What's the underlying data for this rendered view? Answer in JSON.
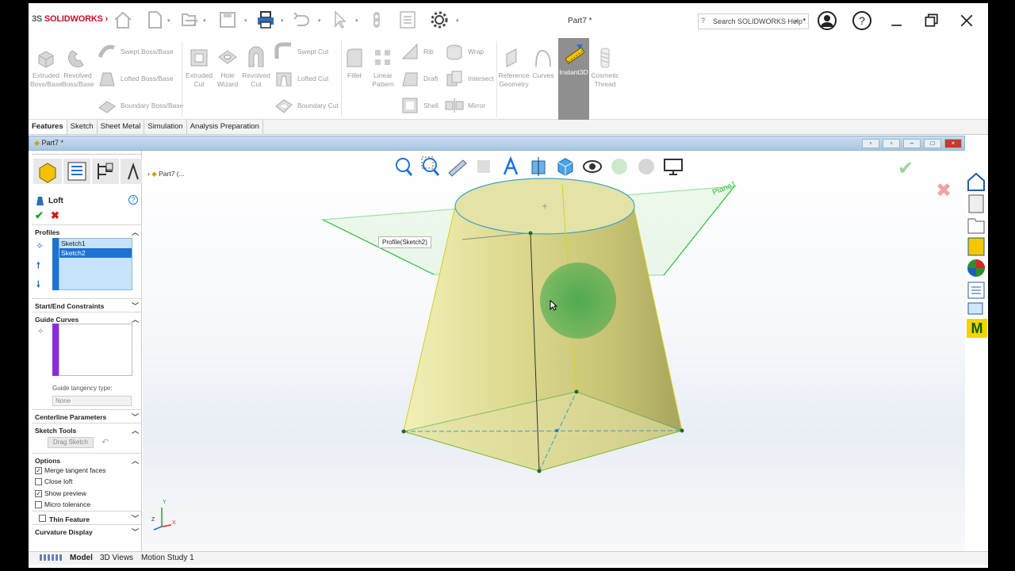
{
  "app": {
    "brand": "SOLIDWORKS",
    "doc_title": "Part7 *",
    "search_placeholder": "Search SOLIDWORKS Help"
  },
  "ribbon": {
    "extruded_boss": "Extruded Boss/Base",
    "revolved_boss": "Revolved Boss/Base",
    "swept_boss": "Swept Boss/Base",
    "lofted_boss": "Lofted Boss/Base",
    "boundary_boss": "Boundary Boss/Base",
    "extruded_cut": "Extruded Cut",
    "hole_wizard": "Hole Wizard",
    "revolved_cut": "Revolved Cut",
    "swept_cut": "Swept Cut",
    "lofted_cut": "Lofted Cut",
    "boundary_cut": "Boundary Cut",
    "fillet": "Fillet",
    "linear_pattern": "Linear Pattern",
    "rib": "Rib",
    "draft": "Draft",
    "shell": "Shell",
    "wrap": "Wrap",
    "intersect": "Intersect",
    "mirror": "Mirror",
    "reference_geometry": "Reference Geometry",
    "curves": "Curves",
    "instant3d": "Instant3D",
    "cosmetic_thread": "Cosmetic Thread"
  },
  "tabs": [
    "Features",
    "Sketch",
    "Sheet Metal",
    "Simulation",
    "Analysis Preparation"
  ],
  "doc_tab": "Part7 *",
  "tree_item": "Part7  (...",
  "pm": {
    "title": "Loft",
    "profiles_label": "Profiles",
    "profiles": [
      "Sketch1",
      "Sketch2"
    ],
    "start_end": "Start/End Constraints",
    "guide_curves": "Guide Curves",
    "tangency_label": "Guide tangency type:",
    "tangency_value": "None",
    "centerline": "Centerline Parameters",
    "sketch_tools": "Sketch Tools",
    "drag_sketch": "Drag Sketch",
    "options": "Options",
    "merge_tangent": "Merge tangent faces",
    "close_loft": "Close loft",
    "show_preview": "Show preview",
    "micro_tolerance": "Micro tolerance",
    "thin_feature": "Thin Feature",
    "curvature_display": "Curvature Display"
  },
  "viewport": {
    "callout": "Profile(Sketch2)",
    "plane_label": "Plane1",
    "triad_x": "X",
    "triad_y": "Y",
    "triad_z": "Z"
  },
  "bottom_tabs": [
    "Model",
    "3D Views",
    "Motion Study 1"
  ],
  "colors": {
    "accent_blue": "#1e73d2",
    "loft_fill": "#e6e4a0",
    "plane_green": "#22c03a",
    "selection_blue": "#1e73d2"
  }
}
